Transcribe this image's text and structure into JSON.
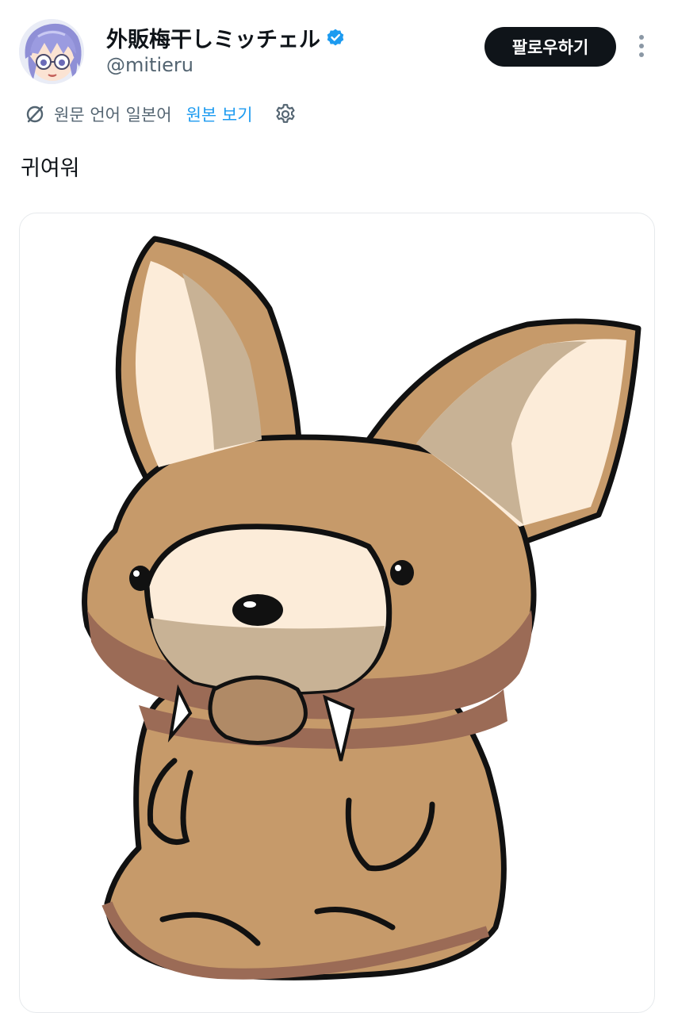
{
  "author": {
    "display_name": "外販梅干しミッチェル",
    "handle": "@mitieru",
    "avatar_icon": "anime-character-avatar",
    "verified_icon": "verified-badge-icon",
    "verified_color": "#1d9bf0"
  },
  "actions": {
    "follow_label": "팔로우하기",
    "more_icon": "more-vertical-icon"
  },
  "translation": {
    "icon": "translate-icon",
    "source_language": "원문 언어 일본어",
    "show_original_label": "원본 보기",
    "settings_icon": "gear-icon",
    "link_color": "#1d9bf0"
  },
  "tweet": {
    "text": "귀여워"
  },
  "media": {
    "description_icon": "cartoon-fennec-fox-illustration"
  }
}
